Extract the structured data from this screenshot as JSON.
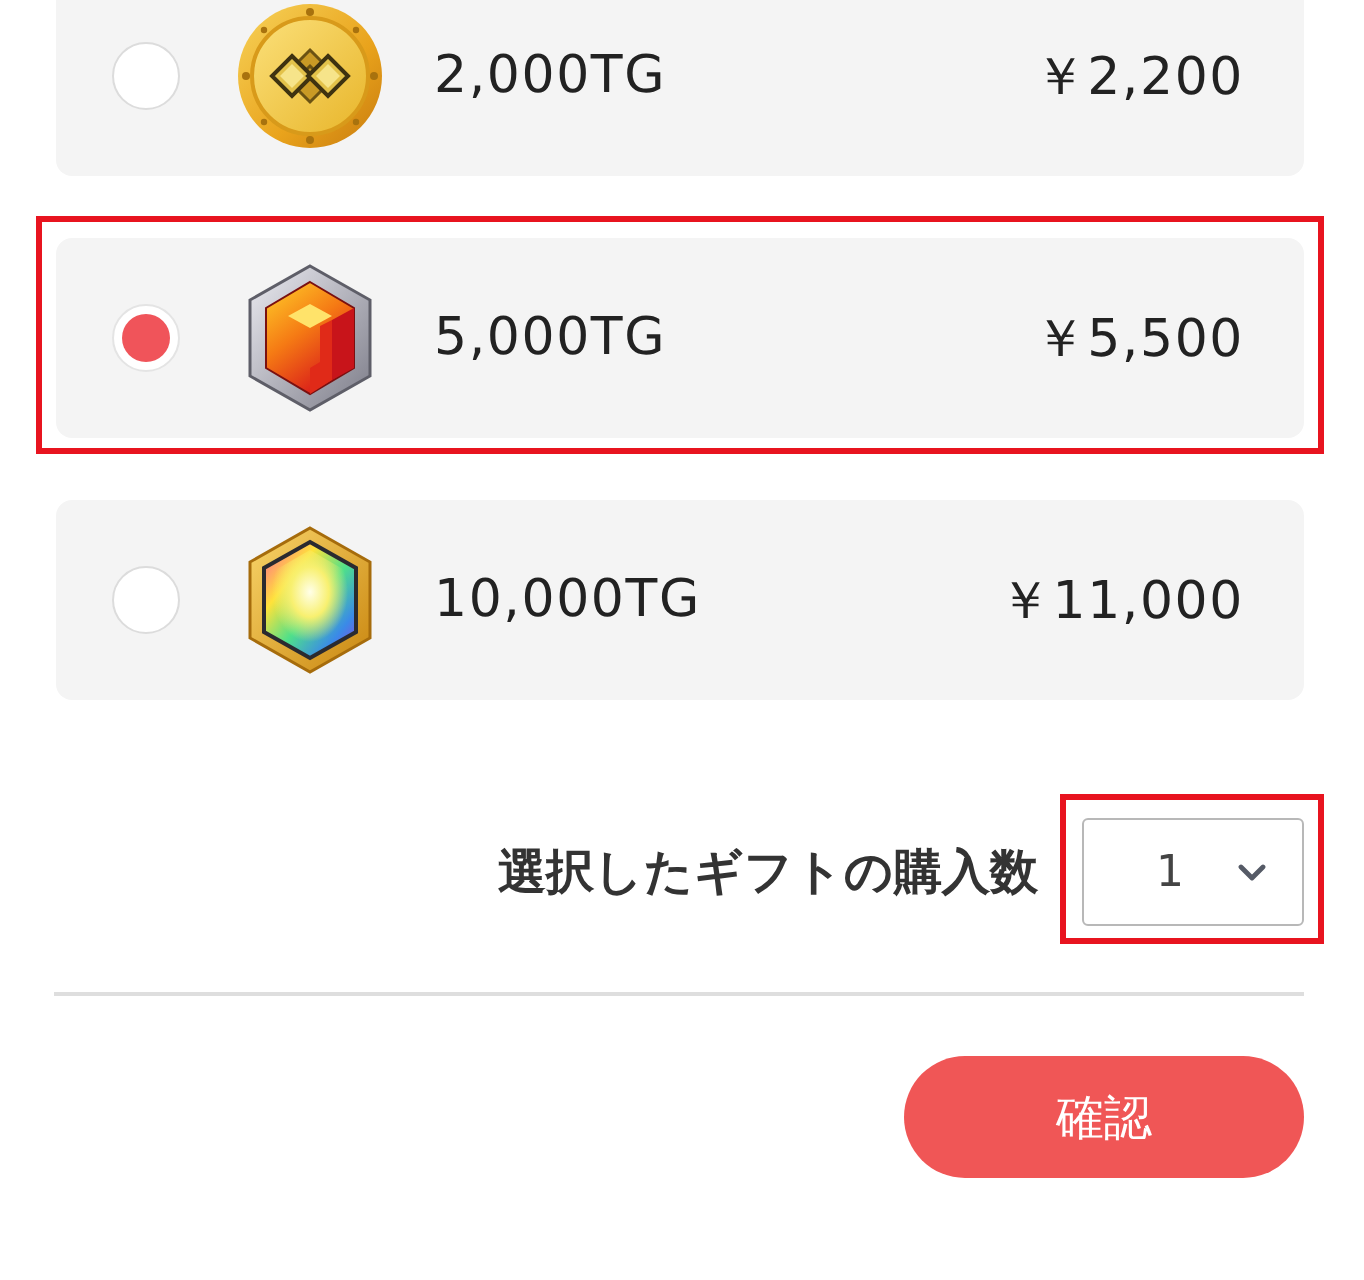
{
  "options": [
    {
      "kind": "coin",
      "amount": "2,000TG",
      "price": "￥2,200",
      "selected": false,
      "highlighted": false
    },
    {
      "kind": "ruby",
      "amount": "5,000TG",
      "price": "￥5,500",
      "selected": true,
      "highlighted": true
    },
    {
      "kind": "rainbow",
      "amount": "10,000TG",
      "price": "￥11,000",
      "selected": false,
      "highlighted": false
    }
  ],
  "quantity": {
    "label": "選択したギフトの購入数",
    "value": "1",
    "highlighted": true
  },
  "confirm_button": {
    "label": "確認"
  }
}
